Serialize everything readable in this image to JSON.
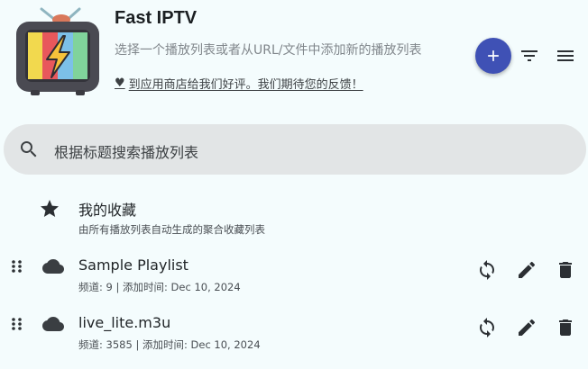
{
  "header": {
    "app_title": "Fast IPTV",
    "subtitle": "选择一个播放列表或者从URL/文件中添加新的播放列表",
    "feedback_text": "到应用商店给我们好评。我们期待您的反馈！"
  },
  "toolbar": {
    "add_icon": "plus-icon",
    "sort_icon": "filter-list-icon",
    "menu_icon": "menu-icon"
  },
  "search": {
    "placeholder": "根据标题搜索播放列表"
  },
  "favorites": {
    "title": "我的收藏",
    "subtitle": "由所有播放列表自动生成的聚合收藏列表"
  },
  "playlists": [
    {
      "title": "Sample Playlist",
      "meta": "频道: 9 | 添加时间: Dec 10, 2024"
    },
    {
      "title": "live_lite.m3u",
      "meta": "频道: 3585 | 添加时间: Dec 10, 2024"
    }
  ],
  "colors": {
    "background": "#f4fcfd",
    "accent": "#3f51b5",
    "search_bg": "#e2e5e6"
  }
}
